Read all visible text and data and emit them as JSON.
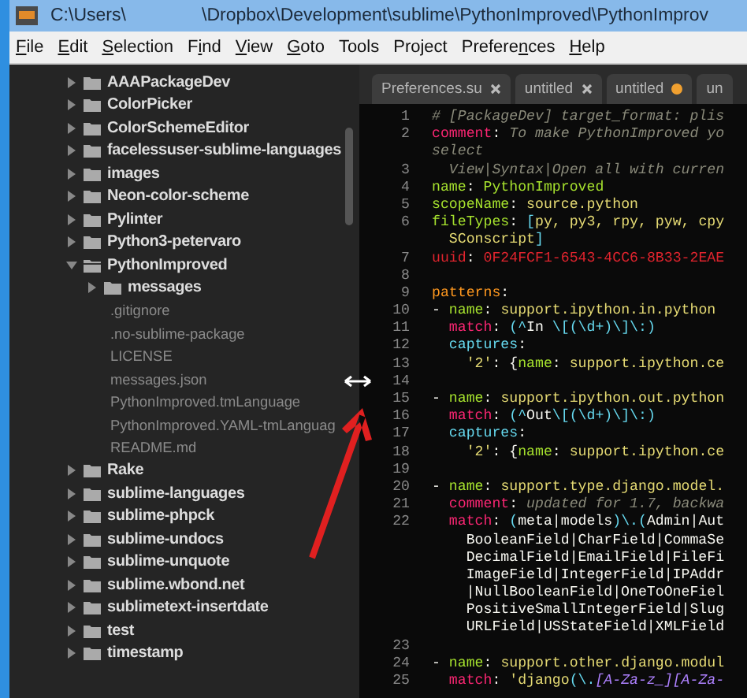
{
  "window": {
    "title_parts": [
      "C:\\Users\\",
      "\\Dropbox\\Development\\sublime\\PythonImproved\\PythonImprov"
    ]
  },
  "menu": [
    {
      "key": "F",
      "after": "ile"
    },
    {
      "key": "E",
      "after": "dit"
    },
    {
      "key": "S",
      "after": "election"
    },
    {
      "before": "F",
      "key": "i",
      "after": "nd"
    },
    {
      "key": "V",
      "after": "iew"
    },
    {
      "key": "G",
      "after": "oto"
    },
    {
      "before": "Tools"
    },
    {
      "before": "Project"
    },
    {
      "before": "Prefere",
      "key": "n",
      "after": "ces"
    },
    {
      "key": "H",
      "after": "elp"
    }
  ],
  "sidebar": {
    "items": [
      {
        "kind": "folder",
        "label": "AAAPackageDev",
        "expanded": false
      },
      {
        "kind": "folder",
        "label": "ColorPicker",
        "expanded": false
      },
      {
        "kind": "folder",
        "label": "ColorSchemeEditor",
        "expanded": false
      },
      {
        "kind": "folder",
        "label": "facelessuser-sublime-languages",
        "expanded": false
      },
      {
        "kind": "folder",
        "label": "images",
        "expanded": false
      },
      {
        "kind": "folder",
        "label": "Neon-color-scheme",
        "expanded": false
      },
      {
        "kind": "folder",
        "label": "Pylinter",
        "expanded": false
      },
      {
        "kind": "folder",
        "label": "Python3-petervaro",
        "expanded": false
      },
      {
        "kind": "folder",
        "label": "PythonImproved",
        "expanded": true,
        "children": [
          {
            "kind": "folder",
            "label": "messages",
            "expanded": false
          },
          {
            "kind": "file",
            "label": ".gitignore"
          },
          {
            "kind": "file",
            "label": ".no-sublime-package"
          },
          {
            "kind": "file",
            "label": "LICENSE"
          },
          {
            "kind": "file",
            "label": "messages.json"
          },
          {
            "kind": "file",
            "label": "PythonImproved.tmLanguage"
          },
          {
            "kind": "file",
            "label": "PythonImproved.YAML-tmLanguag"
          },
          {
            "kind": "file",
            "label": "README.md"
          }
        ]
      },
      {
        "kind": "folder",
        "label": "Rake",
        "expanded": false
      },
      {
        "kind": "folder",
        "label": "sublime-languages",
        "expanded": false
      },
      {
        "kind": "folder",
        "label": "sublime-phpck",
        "expanded": false
      },
      {
        "kind": "folder",
        "label": "sublime-undocs",
        "expanded": false
      },
      {
        "kind": "folder",
        "label": "sublime-unquote",
        "expanded": false
      },
      {
        "kind": "folder",
        "label": "sublime.wbond.net",
        "expanded": false
      },
      {
        "kind": "folder",
        "label": "sublimetext-insertdate",
        "expanded": false
      },
      {
        "kind": "folder",
        "label": "test",
        "expanded": false
      },
      {
        "kind": "folder",
        "label": "timestamp",
        "expanded": false
      }
    ]
  },
  "tabs": [
    {
      "label": "Preferences.su",
      "dirty": false
    },
    {
      "label": "untitled",
      "dirty": false
    },
    {
      "label": "untitled",
      "dirty": true
    },
    {
      "label": "un"
    }
  ],
  "code_lines": [
    {
      "number": "1",
      "tokens": [
        {
          "text": "# [PackageDev] target_format: plis",
          "kind": "comment"
        }
      ]
    },
    {
      "number": "2",
      "tokens": [
        {
          "text": "comment",
          "kind": "pink"
        },
        {
          "text": ": ",
          "kind": "plain"
        },
        {
          "text": "To make PythonImproved yo",
          "kind": "comment"
        }
      ]
    },
    {
      "tokens": [
        {
          "text": "select",
          "kind": "comment"
        }
      ]
    },
    {
      "number": "3",
      "tokens": [
        {
          "text": "  View|Syntax|Open all with curren",
          "kind": "comment"
        }
      ]
    },
    {
      "number": "4",
      "tokens": [
        {
          "text": "name",
          "kind": "green"
        },
        {
          "text": ": ",
          "kind": "plain"
        },
        {
          "text": "PythonImproved",
          "kind": "green"
        }
      ]
    },
    {
      "number": "5",
      "tokens": [
        {
          "text": "scopeName",
          "kind": "green"
        },
        {
          "text": ": ",
          "kind": "plain"
        },
        {
          "text": "source.python",
          "kind": "yellow"
        }
      ]
    },
    {
      "number": "6",
      "tokens": [
        {
          "text": "fileTypes",
          "kind": "green"
        },
        {
          "text": ": ",
          "kind": "plain"
        },
        {
          "text": "[",
          "kind": "cyan"
        },
        {
          "text": "py, py3, rpy, pyw, cpy",
          "kind": "yellow"
        }
      ]
    },
    {
      "tokens": [
        {
          "text": "  SConscript",
          "kind": "yellow"
        },
        {
          "text": "]",
          "kind": "cyan"
        }
      ]
    },
    {
      "number": "7",
      "tokens": [
        {
          "text": "uuid",
          "kind": "red"
        },
        {
          "text": ": ",
          "kind": "plain"
        },
        {
          "text": "0F24FCF1-6543-4CC6-8B33-2EAE",
          "kind": "red"
        }
      ]
    },
    {
      "number": "8"
    },
    {
      "number": "9",
      "tokens": [
        {
          "text": "patterns",
          "kind": "orange"
        },
        {
          "text": ":",
          "kind": "plain"
        }
      ]
    },
    {
      "number": "10",
      "tokens": [
        {
          "text": "- ",
          "kind": "plain"
        },
        {
          "text": "name",
          "kind": "green"
        },
        {
          "text": ": ",
          "kind": "plain"
        },
        {
          "text": "support.ipython.in.python",
          "kind": "yellow"
        }
      ]
    },
    {
      "number": "11",
      "tokens": [
        {
          "text": "  match",
          "kind": "pink"
        },
        {
          "text": ": ",
          "kind": "plain"
        },
        {
          "text": "(^",
          "kind": "cyan"
        },
        {
          "text": "In ",
          "kind": "plain"
        },
        {
          "text": "\\[(\\d+)\\]\\:)",
          "kind": "cyan"
        }
      ]
    },
    {
      "number": "12",
      "tokens": [
        {
          "text": "  captures",
          "kind": "cyan"
        },
        {
          "text": ":",
          "kind": "plain"
        }
      ]
    },
    {
      "number": "13",
      "tokens": [
        {
          "text": "    '2'",
          "kind": "yellow"
        },
        {
          "text": ": {",
          "kind": "plain"
        },
        {
          "text": "name",
          "kind": "green"
        },
        {
          "text": ": ",
          "kind": "plain"
        },
        {
          "text": "support.ipython.ce",
          "kind": "yellow"
        }
      ]
    },
    {
      "number": "14"
    },
    {
      "number": "15",
      "tokens": [
        {
          "text": "- ",
          "kind": "plain"
        },
        {
          "text": "name",
          "kind": "green"
        },
        {
          "text": ": ",
          "kind": "plain"
        },
        {
          "text": "support.ipython.out.python",
          "kind": "yellow"
        }
      ]
    },
    {
      "number": "16",
      "tokens": [
        {
          "text": "  match",
          "kind": "pink"
        },
        {
          "text": ": ",
          "kind": "plain"
        },
        {
          "text": "(^",
          "kind": "cyan"
        },
        {
          "text": "Out",
          "kind": "plain"
        },
        {
          "text": "\\[(\\d+)\\]\\:)",
          "kind": "cyan"
        }
      ]
    },
    {
      "number": "17",
      "tokens": [
        {
          "text": "  captures",
          "kind": "cyan"
        },
        {
          "text": ":",
          "kind": "plain"
        }
      ]
    },
    {
      "number": "18",
      "tokens": [
        {
          "text": "    '2'",
          "kind": "yellow"
        },
        {
          "text": ": {",
          "kind": "plain"
        },
        {
          "text": "name",
          "kind": "green"
        },
        {
          "text": ": ",
          "kind": "plain"
        },
        {
          "text": "support.ipython.ce",
          "kind": "yellow"
        }
      ]
    },
    {
      "number": "19"
    },
    {
      "number": "20",
      "tokens": [
        {
          "text": "- ",
          "kind": "plain"
        },
        {
          "text": "name",
          "kind": "green"
        },
        {
          "text": ": ",
          "kind": "plain"
        },
        {
          "text": "support.type.django.model.",
          "kind": "yellow"
        }
      ]
    },
    {
      "number": "21",
      "tokens": [
        {
          "text": "  comment",
          "kind": "pink"
        },
        {
          "text": ": ",
          "kind": "plain"
        },
        {
          "text": "updated for 1.7, backwa",
          "kind": "comment"
        }
      ]
    },
    {
      "number": "22",
      "tokens": [
        {
          "text": "  match",
          "kind": "pink"
        },
        {
          "text": ": ",
          "kind": "plain"
        },
        {
          "text": "(",
          "kind": "cyan"
        },
        {
          "text": "meta|models",
          "kind": "plain"
        },
        {
          "text": ")\\.(",
          "kind": "cyan"
        },
        {
          "text": "Admin|Aut",
          "kind": "plain"
        }
      ]
    },
    {
      "tokens": [
        {
          "text": "    BooleanField|CharField|CommaSe",
          "kind": "plain"
        }
      ]
    },
    {
      "tokens": [
        {
          "text": "    DecimalField|EmailField|FileFi",
          "kind": "plain"
        }
      ]
    },
    {
      "tokens": [
        {
          "text": "    ImageField|IntegerField|IPAddr",
          "kind": "plain"
        }
      ]
    },
    {
      "tokens": [
        {
          "text": "    |NullBooleanField|OneToOneFiel",
          "kind": "plain"
        }
      ]
    },
    {
      "tokens": [
        {
          "text": "    PositiveSmallIntegerField|Slug",
          "kind": "plain"
        }
      ]
    },
    {
      "tokens": [
        {
          "text": "    URLField|USStateField|XMLField",
          "kind": "plain"
        }
      ]
    },
    {
      "number": "23"
    },
    {
      "number": "24",
      "tokens": [
        {
          "text": "- ",
          "kind": "plain"
        },
        {
          "text": "name",
          "kind": "green"
        },
        {
          "text": ": ",
          "kind": "plain"
        },
        {
          "text": "support.other.django.modul",
          "kind": "yellow"
        }
      ]
    },
    {
      "number": "25",
      "tokens": [
        {
          "text": "  match",
          "kind": "pink"
        },
        {
          "text": ": ",
          "kind": "plain"
        },
        {
          "text": "'django",
          "kind": "yellow"
        },
        {
          "text": "(\\.",
          "kind": "cyan"
        },
        {
          "text": "[A-Za-z_][A-Za-",
          "kind": "purple"
        }
      ]
    }
  ]
}
